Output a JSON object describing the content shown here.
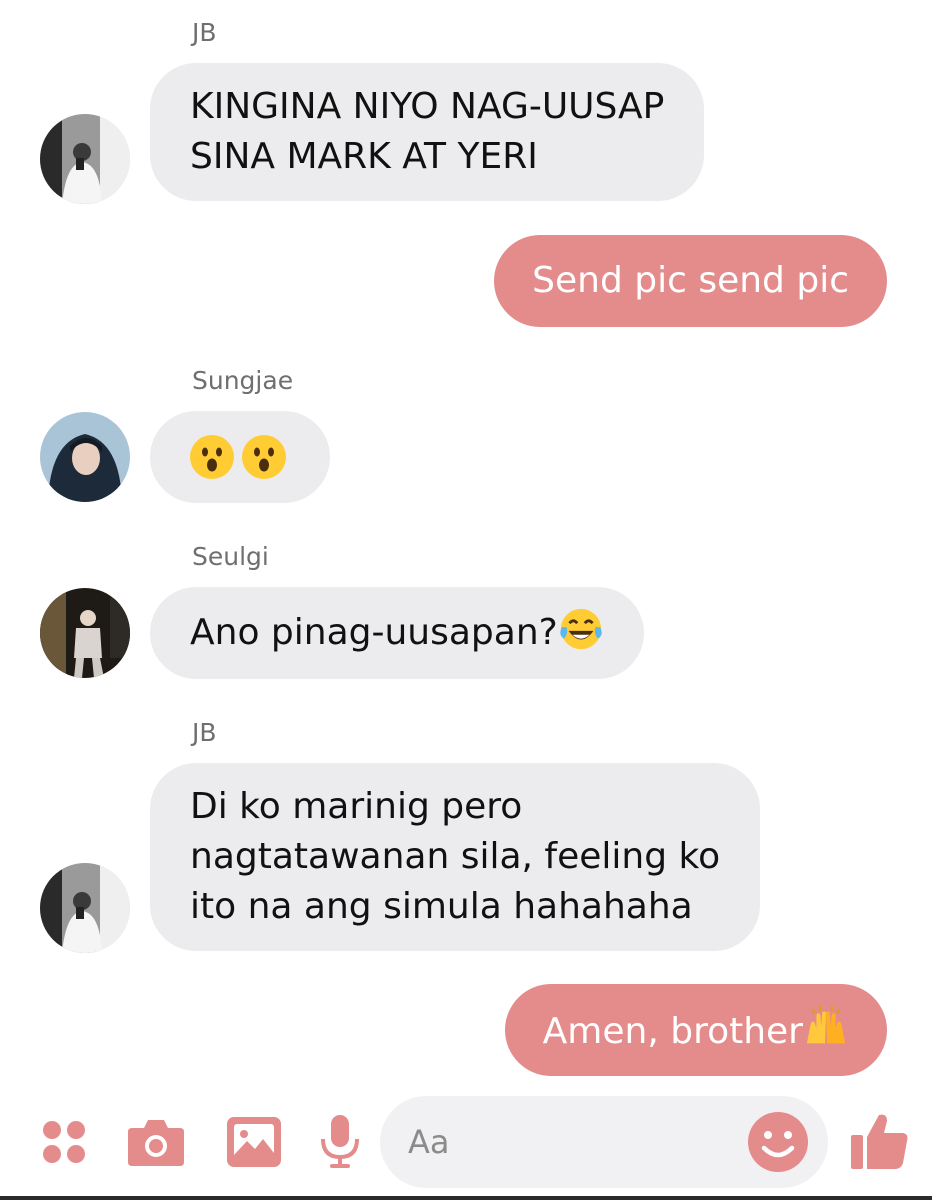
{
  "colors": {
    "accent": "#e48b8b",
    "incoming_bubble": "#ececee",
    "outgoing_text": "#ffffff",
    "sender_name": "#6f6f6f"
  },
  "messages": [
    {
      "sender": "JB",
      "lines": [
        "KINGINA NIYO NAG-UUSAP",
        "SINA MARK AT YERI"
      ]
    },
    {
      "outgoing": true,
      "text": "Send pic send pic"
    },
    {
      "sender": "Sungjae",
      "emoji": [
        "hushed-face",
        "hushed-face"
      ]
    },
    {
      "sender": "Seulgi",
      "text": "Ano pinag-uusapan?",
      "trailing_emoji": "face-with-tears-of-joy"
    },
    {
      "sender": "JB",
      "lines": [
        "Di ko marinig pero",
        "nagtatawanan sila, feeling ko",
        "ito na ang simula hahahaha"
      ]
    },
    {
      "outgoing": true,
      "text": "Amen, brother",
      "trailing_emoji": "raising-hands"
    }
  ],
  "composer": {
    "placeholder": "Aa",
    "icons": [
      "apps-icon",
      "camera-icon",
      "gallery-icon",
      "microphone-icon",
      "emoji-icon",
      "thumbs-up-icon"
    ]
  }
}
